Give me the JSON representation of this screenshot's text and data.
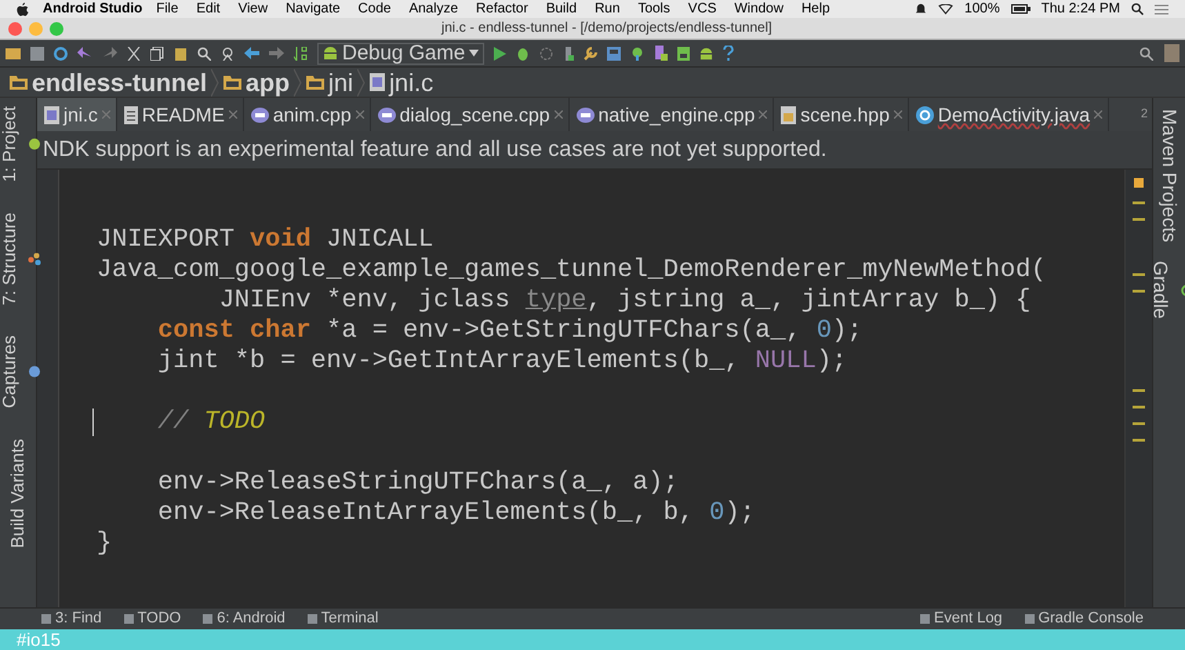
{
  "menubar": {
    "app_name": "Android Studio",
    "menus": [
      "File",
      "Edit",
      "View",
      "Navigate",
      "Code",
      "Analyze",
      "Refactor",
      "Build",
      "Run",
      "Tools",
      "VCS",
      "Window",
      "Help"
    ],
    "battery": "100%",
    "clock": "Thu 2:24 PM"
  },
  "window": {
    "title": "jni.c - endless-tunnel - [/demo/projects/endless-tunnel]"
  },
  "toolbar": {
    "run_config": "Debug Game"
  },
  "breadcrumb": [
    "endless-tunnel",
    "app",
    "jni",
    "jni.c"
  ],
  "tabs": [
    {
      "label": "jni.c",
      "selected": true,
      "kind": "c"
    },
    {
      "label": "README",
      "selected": false,
      "kind": "text"
    },
    {
      "label": "anim.cpp",
      "selected": false,
      "kind": "cpp"
    },
    {
      "label": "dialog_scene.cpp",
      "selected": false,
      "kind": "cpp"
    },
    {
      "label": "native_engine.cpp",
      "selected": false,
      "kind": "cpp"
    },
    {
      "label": "scene.hpp",
      "selected": false,
      "kind": "header"
    },
    {
      "label": "DemoActivity.java",
      "selected": false,
      "kind": "java"
    }
  ],
  "tab_overflow": "2",
  "notice": "NDK support is an experimental feature and all use cases are not yet supported.",
  "left_tools": [
    "1: Project",
    "7: Structure",
    "Captures",
    "Build Variants"
  ],
  "right_tools": [
    "Maven Projects",
    "Gradle"
  ],
  "code_lines": [
    {
      "caret": false,
      "tokens": [
        {
          "kind": "plain",
          "text": "JNIEXPORT "
        },
        {
          "kind": "keyword",
          "text": "void"
        },
        {
          "kind": "plain",
          "text": " JNICALL"
        }
      ]
    },
    {
      "caret": false,
      "tokens": [
        {
          "kind": "plain",
          "text": "Java_com_google_example_games_tunnel_DemoRenderer_myNewMethod("
        }
      ]
    },
    {
      "caret": false,
      "tokens": [
        {
          "kind": "plain",
          "text": "        JNIEnv *env, jclass "
        },
        {
          "kind": "unused",
          "text": "type"
        },
        {
          "kind": "plain",
          "text": ", jstring a_, jintArray b_) {"
        }
      ]
    },
    {
      "caret": false,
      "tokens": [
        {
          "kind": "keyword",
          "text": "    const char"
        },
        {
          "kind": "plain",
          "text": " *a = env->GetStringUTFChars(a_, "
        },
        {
          "kind": "number",
          "text": "0"
        },
        {
          "kind": "plain",
          "text": ");"
        }
      ]
    },
    {
      "caret": false,
      "tokens": [
        {
          "kind": "plain",
          "text": "    jint *b = env->GetIntArrayElements(b_, "
        },
        {
          "kind": "constant",
          "text": "NULL"
        },
        {
          "kind": "plain",
          "text": ");"
        }
      ]
    },
    {
      "caret": false
    },
    {
      "caret": true,
      "tokens": [
        {
          "kind": "comment",
          "text": "    // "
        },
        {
          "kind": "todo",
          "text": "TODO"
        }
      ]
    },
    {
      "caret": false
    },
    {
      "caret": false,
      "tokens": [
        {
          "kind": "plain",
          "text": "    env->ReleaseStringUTFChars(a_, a);"
        }
      ]
    },
    {
      "caret": false,
      "tokens": [
        {
          "kind": "plain",
          "text": "    env->ReleaseIntArrayElements(b_, b, "
        },
        {
          "kind": "number",
          "text": "0"
        },
        {
          "kind": "plain",
          "text": ");"
        }
      ]
    },
    {
      "caret": false,
      "tokens": [
        {
          "kind": "plain",
          "text": "}"
        }
      ]
    }
  ],
  "bottom_tools_left": [
    "3: Find",
    "TODO",
    "6: Android",
    "Terminal"
  ],
  "bottom_tools_right": [
    "Event Log",
    "Gradle Console"
  ],
  "banner": "#io15"
}
